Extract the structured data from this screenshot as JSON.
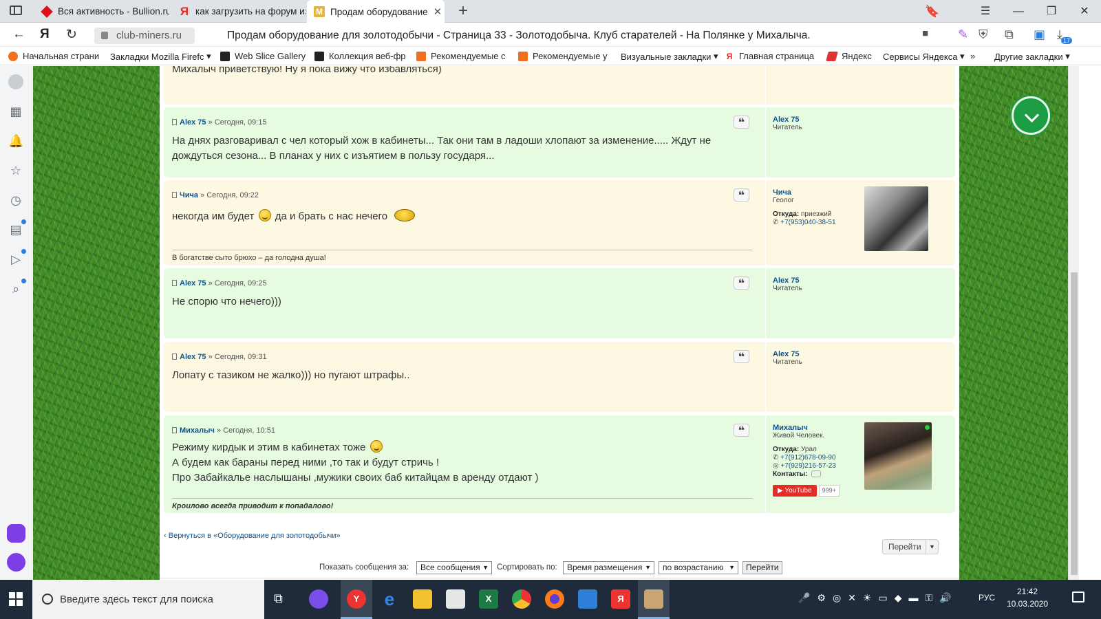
{
  "browser": {
    "tabs": [
      {
        "title": "Вся активность - Bullion.ru",
        "icon": "bullion-diamond-icon"
      },
      {
        "title": "как загрузить на форум из",
        "icon": "yandex-icon"
      },
      {
        "title": "Продам оборудование",
        "icon": "miners-club-icon",
        "active": true
      }
    ],
    "url_domain": "club-miners.ru",
    "page_title": "Продам оборудование для золотодобычи - Страница 33 - Золотодобыча. Клуб старателей - На Полянке у Михалыча.",
    "downloads_badge": "17",
    "bookmarks": [
      "Начальная страни",
      "Закладки Mozilla Firefc",
      "Web Slice Gallery",
      "Коллекция веб-фр",
      "Рекомендуемые с",
      "Рекомендуемые у",
      "Визуальные закладки",
      "Главная страница",
      "Яндекс",
      "Сервисы Яндекса",
      "»",
      "Другие закладки"
    ]
  },
  "posts": [
    {
      "body": "Михалыч приветствую! Ну я пока вижу что избавляться)"
    },
    {
      "author": "Alex 75",
      "sep": " » ",
      "time": "Сегодня, 09:15",
      "body": "На днях разговаривал с чел который хож в кабинеты... Так они там в ладоши хлопают за изменение..... Ждут не дождуться сезона... В планах у них с изъятием в пользу государя...",
      "profile_name": "Alex 75",
      "rank": "Читатель"
    },
    {
      "author": "Чича",
      "sep": " » ",
      "time": "Сегодня, 09:22",
      "body_a": "некогда им будет",
      "body_b": "да и брать с нас нечего",
      "signature": "В богатстве сыто брюхо – да голодна душа!",
      "profile_name": "Чича",
      "rank": "Геолог",
      "from_label": "Откуда:",
      "from_value": "приезжий",
      "phone": "+7(953)040-38-51"
    },
    {
      "author": "Alex 75",
      "sep": " » ",
      "time": "Сегодня, 09:25",
      "body": "Не спорю что нечего)))",
      "profile_name": "Alex 75",
      "rank": "Читатель"
    },
    {
      "author": "Alex 75",
      "sep": " » ",
      "time": "Сегодня, 09:31",
      "body": "Лопату с тазиком не жалко))) но пугают штрафы..",
      "profile_name": "Alex 75",
      "rank": "Читатель"
    },
    {
      "author": "Михалыч",
      "sep": " » ",
      "time": "Сегодня, 10:51",
      "line1": "Режиму кирдык и этим в кабинетах тоже",
      "line2": "А будем как бараны перед ними ,то так и будут стричь !",
      "line3": "Про Забайкалье наслышаны ,мужики своих баб китайцам в аренду отдают )",
      "signature": "Кроилово всегда приводит к попадалово!",
      "profile_name": "Михалыч",
      "rank": "Живой Человек.",
      "from_label": "Откуда:",
      "from_value": "Урал",
      "phone": "+7(912)678-09-90",
      "whatsapp": "+7(929)216-57-23",
      "contacts_label": "Контакты:",
      "youtube": "YouTube",
      "youtube_count": "999+"
    }
  ],
  "footer": {
    "back_link": "Вернуться в «Оборудование для золотодобычи»",
    "jump_button": "Перейти",
    "show_label": "Показать сообщения за:",
    "show_value": "Все сообщения",
    "sort_label": "Сортировать по:",
    "sort_value": "Время размещения",
    "order_value": "по возрастанию",
    "go_button": "Перейти"
  },
  "taskbar": {
    "search_placeholder": "Введите здесь текст для поиска",
    "lang": "РУС",
    "time": "21:42",
    "date": "10.03.2020"
  }
}
